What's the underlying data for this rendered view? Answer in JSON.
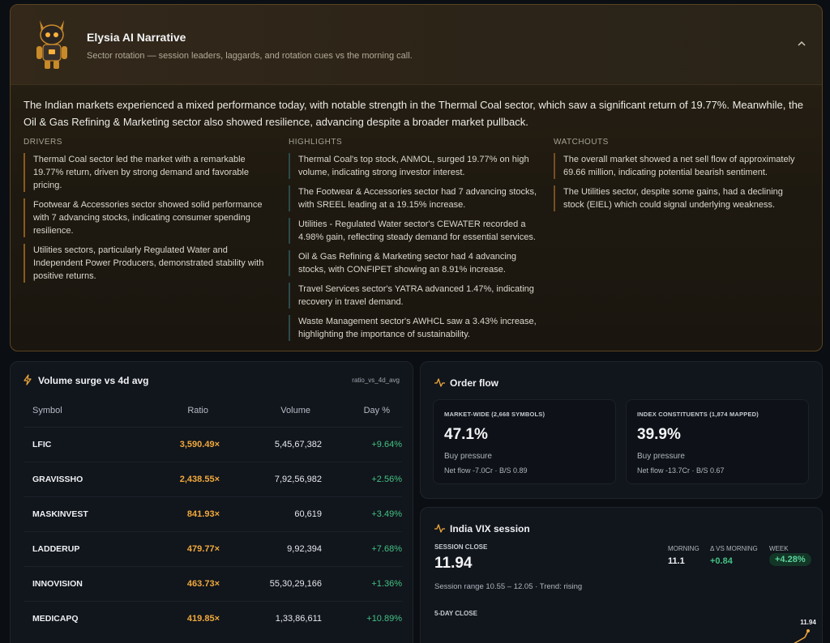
{
  "narrative": {
    "title": "Elysia AI Narrative",
    "subtitle": "Sector rotation — session leaders, laggards, and rotation cues vs the morning call.",
    "lead": "The Indian markets experienced a mixed performance today, with notable strength in the Thermal Coal sector, which saw a significant return of 19.77%. Meanwhile, the Oil & Gas Refining & Marketing sector also showed resilience, advancing despite a broader market pullback.",
    "drivers_title": "DRIVERS",
    "drivers": [
      "Thermal Coal sector led the market with a remarkable 19.77% return, driven by strong demand and favorable pricing.",
      "Footwear & Accessories sector showed solid performance with 7 advancing stocks, indicating consumer spending resilience.",
      "Utilities sectors, particularly Regulated Water and Independent Power Producers, demonstrated stability with positive returns."
    ],
    "highlights_title": "HIGHLIGHTS",
    "highlights": [
      "Thermal Coal's top stock, ANMOL, surged 19.77% on high volume, indicating strong investor interest.",
      "The Footwear & Accessories sector had 7 advancing stocks, with SREEL leading at a 19.15% increase.",
      "Utilities - Regulated Water sector's CEWATER recorded a 4.98% gain, reflecting steady demand for essential services.",
      "Oil & Gas Refining & Marketing sector had 4 advancing stocks, with CONFIPET showing an 8.91% increase.",
      "Travel Services sector's YATRA advanced 1.47%, indicating recovery in travel demand.",
      "Waste Management sector's AWHCL saw a 3.43% increase, highlighting the importance of sustainability."
    ],
    "watchouts_title": "WATCHOUTS",
    "watchouts": [
      "The overall market showed a net sell flow of approximately 69.66 million, indicating potential bearish sentiment.",
      "The Utilities sector, despite some gains, had a declining stock (EIEL) which could signal underlying weakness."
    ],
    "icons": {
      "avatar": "robot-mascot-icon",
      "collapse": "chevron-up-icon"
    }
  },
  "volume": {
    "title": "Volume surge vs 4d avg",
    "tag": "ratio_vs_4d_avg",
    "headers": {
      "symbol": "Symbol",
      "ratio": "Ratio",
      "volume": "Volume",
      "day": "Day %"
    },
    "rows": [
      {
        "symbol": "LFIC",
        "ratio": "3,590.49×",
        "volume": "5,45,67,382",
        "day": "+9.64%"
      },
      {
        "symbol": "GRAVISSHO",
        "ratio": "2,438.55×",
        "volume": "7,92,56,982",
        "day": "+2.56%"
      },
      {
        "symbol": "MASKINVEST",
        "ratio": "841.93×",
        "volume": "60,619",
        "day": "+3.49%"
      },
      {
        "symbol": "LADDERUP",
        "ratio": "479.77×",
        "volume": "9,92,394",
        "day": "+7.68%"
      },
      {
        "symbol": "INNOVISION",
        "ratio": "463.73×",
        "volume": "55,30,29,166",
        "day": "+1.36%"
      },
      {
        "symbol": "MEDICAPQ",
        "ratio": "419.85×",
        "volume": "1,33,86,611",
        "day": "+10.89%"
      }
    ],
    "icon": "lightning-bolt-icon",
    "accent": "#f0a93b",
    "positive": "#43c283"
  },
  "order_flow": {
    "title": "Order flow",
    "icon": "pulse-line-icon",
    "market": {
      "label": "MARKET-WIDE (2,668 SYMBOLS)",
      "value": "47.1%",
      "caption": "Buy pressure",
      "flow": "Net flow -7.0Cr · B/S 0.89"
    },
    "index": {
      "label": "INDEX CONSTITUENTS (1,874 MAPPED)",
      "value": "39.9%",
      "caption": "Buy pressure",
      "flow": "Net flow -13.7Cr · B/S 0.67"
    }
  },
  "vix": {
    "title": "India VIX session",
    "icon": "pulse-line-icon",
    "close_label": "SESSION CLOSE",
    "close": "11.94",
    "range": "Session range 10.55 – 12.05 · Trend: rising",
    "morning_label": "MORNING",
    "morning": "11.1",
    "delta_label": "Δ VS MORNING",
    "delta": "+0.84",
    "week_label": "WEEK",
    "week": "+4.28%",
    "five_day_label": "5-DAY CLOSE",
    "spark_last": "11.94"
  }
}
